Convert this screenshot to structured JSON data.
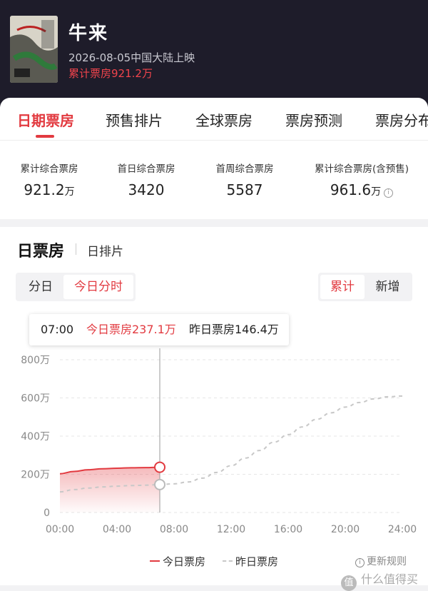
{
  "header": {
    "title": "牛来",
    "release_info": "2026-08-05中国大陆上映",
    "total_box_office": "累计票房921.2万",
    "poster_icon": "movie-poster"
  },
  "tabs": [
    "日期票房",
    "预售排片",
    "全球票房",
    "票房预测",
    "票房分布"
  ],
  "active_tab": 0,
  "stats": [
    {
      "label": "累计综合票房",
      "value": "921.2",
      "unit": "万"
    },
    {
      "label": "首日综合票房",
      "value": "3420",
      "unit": ""
    },
    {
      "label": "首周综合票房",
      "value": "5587",
      "unit": ""
    },
    {
      "label": "累计综合票房(含预售)",
      "value": "961.6",
      "unit": "万"
    }
  ],
  "section": {
    "title": "日票房",
    "subtitle": "日排片"
  },
  "left_toggle": {
    "options": [
      "分日",
      "今日分时"
    ],
    "selected": "今日分时"
  },
  "right_toggle": {
    "options": [
      "累计",
      "新增"
    ],
    "selected": "累计"
  },
  "tooltip": {
    "time": "07:00",
    "today": "今日票房237.1万",
    "yesterday": "昨日票房146.4万"
  },
  "legend": {
    "today": "今日票房",
    "yesterday": "昨日票房",
    "rules": "更新规则"
  },
  "watermark": "什么值得买",
  "colors": {
    "accent": "#e23a40",
    "header_bg": "#1e1c2a",
    "yesterday_line": "#c8c8c8"
  },
  "chart_data": {
    "type": "line",
    "x_ticks": [
      "00:00",
      "04:00",
      "08:00",
      "12:00",
      "16:00",
      "20:00",
      "24:00"
    ],
    "y_ticks": [
      "0",
      "200万",
      "400万",
      "600万",
      "800万"
    ],
    "ylim": [
      0,
      800
    ],
    "xlim": [
      0,
      24
    ],
    "series": [
      {
        "name": "今日票房",
        "style": "solid-area",
        "x": [
          0,
          1,
          2,
          3,
          4,
          5,
          6,
          7
        ],
        "y": [
          203,
          215,
          224,
          229,
          232,
          234,
          235,
          237.1
        ]
      },
      {
        "name": "昨日票房",
        "style": "dashed",
        "x": [
          0,
          1,
          2,
          3,
          4,
          5,
          6,
          7,
          8,
          9,
          10,
          11,
          12,
          13,
          14,
          15,
          16,
          17,
          18,
          19,
          20,
          21,
          22,
          23,
          24
        ],
        "y": [
          108,
          120,
          128,
          134,
          138,
          141,
          143,
          146.4,
          150,
          160,
          180,
          210,
          245,
          285,
          325,
          368,
          408,
          448,
          488,
          522,
          552,
          576,
          595,
          606,
          610
        ]
      }
    ],
    "cursor_x": 7,
    "grid": true
  }
}
